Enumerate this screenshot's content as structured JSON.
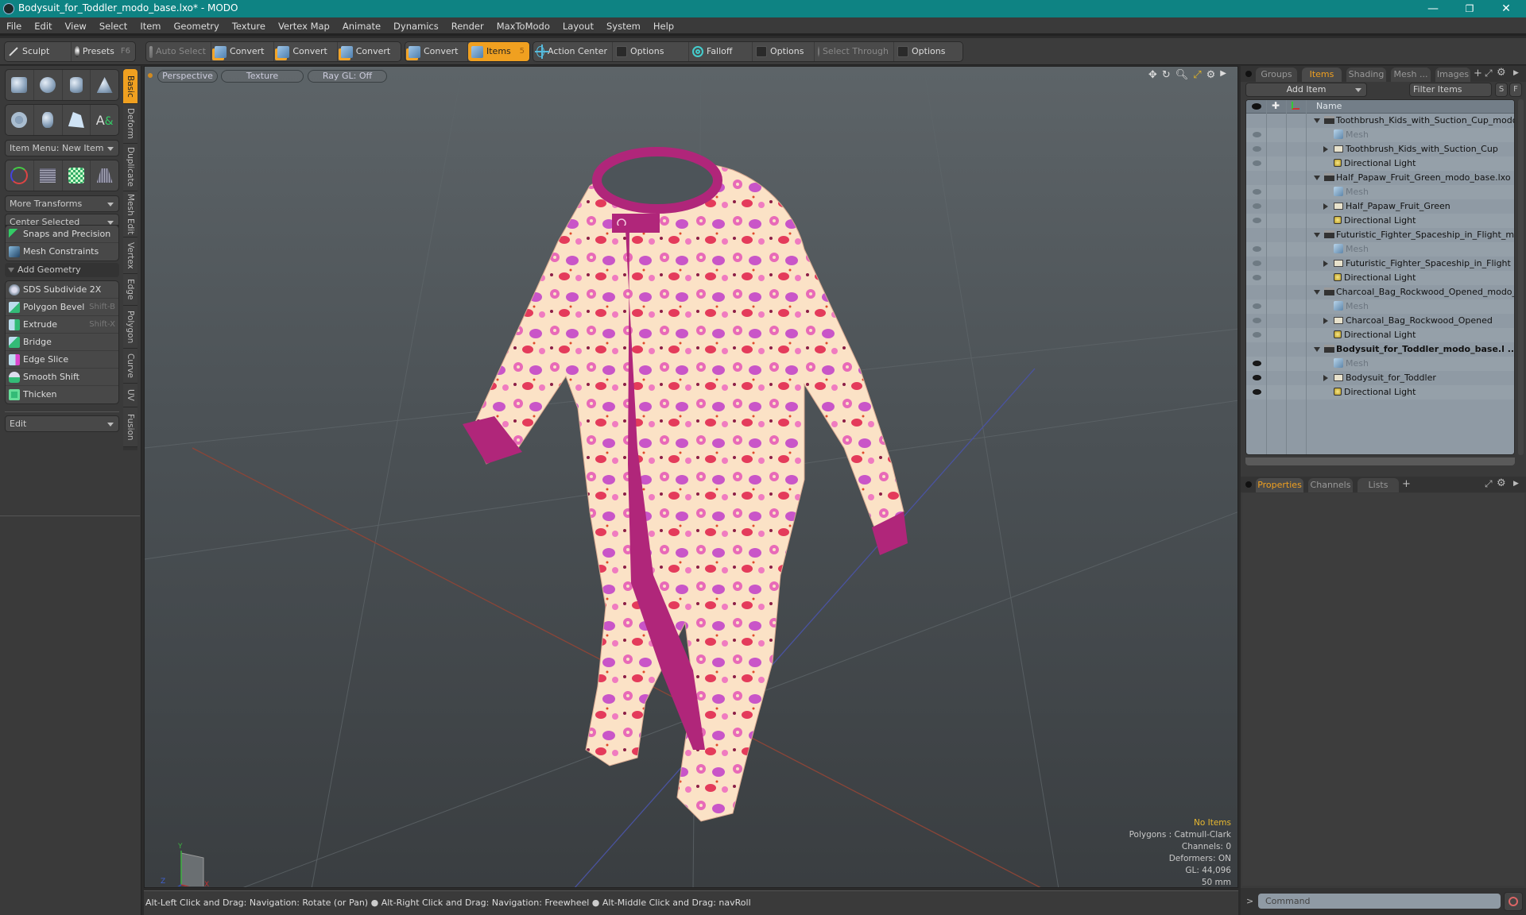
{
  "window": {
    "title": "Bodysuit_for_Toddler_modo_base.lxo* - MODO",
    "controls": {
      "minimize": "—",
      "maximize": "❐",
      "close": "✕"
    }
  },
  "menu": [
    "File",
    "Edit",
    "View",
    "Select",
    "Item",
    "Geometry",
    "Texture",
    "Vertex Map",
    "Animate",
    "Dynamics",
    "Render",
    "MaxToModo",
    "Layout",
    "System",
    "Help"
  ],
  "toolbar": {
    "sculpt": "Sculpt",
    "presets": "Presets",
    "presets_key": "F6",
    "auto_select": "Auto Select",
    "convert1": "Convert",
    "convert2": "Convert",
    "convert3": "Convert",
    "convert4": "Convert",
    "items": "Items",
    "items_count": "5",
    "action_center": "Action Center",
    "options1": "Options",
    "falloff": "Falloff",
    "options2": "Options",
    "select_through": "Select Through",
    "options3": "Options"
  },
  "left_panel": {
    "item_menu": "Item Menu: New Item",
    "more_transforms": "More Transforms",
    "center_selected": "Center Selected",
    "snaps": "Snaps and Precision",
    "mesh_constraints": "Mesh Constraints",
    "add_geometry": "Add Geometry",
    "tools": [
      {
        "label": "SDS Subdivide 2X",
        "shortcut": ""
      },
      {
        "label": "Polygon Bevel",
        "shortcut": "Shift-B"
      },
      {
        "label": "Extrude",
        "shortcut": "Shift-X"
      },
      {
        "label": "Bridge",
        "shortcut": ""
      },
      {
        "label": "Edge Slice",
        "shortcut": ""
      },
      {
        "label": "Smooth Shift",
        "shortcut": ""
      },
      {
        "label": "Thicken",
        "shortcut": ""
      }
    ],
    "edit_dropdown": "Edit",
    "vertical_tabs": [
      "Basic",
      "Deform",
      "Duplicate",
      "Mesh Edit",
      "Vertex",
      "Edge",
      "Polygon",
      "Curve",
      "UV",
      "Fusion"
    ]
  },
  "viewport": {
    "view": "Perspective",
    "shading": "Texture",
    "raygl": "Ray GL: Off",
    "info": {
      "selection": "No Items",
      "polygons": "Polygons : Catmull-Clark",
      "channels": "Channels: 0",
      "deformers": "Deformers: ON",
      "gl": "GL: 44,096",
      "focal": "50 mm"
    },
    "axis": {
      "x": "X",
      "y": "Y",
      "z": "Z"
    }
  },
  "right_panel": {
    "tabs": [
      "Groups",
      "Items",
      "Shading",
      "Mesh ...",
      "Images"
    ],
    "active_tab": "Items",
    "add_item": "Add Item",
    "filter_placeholder": "Filter Items",
    "s_btn": "S",
    "f_btn": "F",
    "name_header": "Name",
    "items": [
      {
        "type": "scene",
        "label": "Toothbrush_Kids_with_Suction_Cup_modo ...",
        "visible": false,
        "bold": false
      },
      {
        "type": "mesh",
        "label": "Mesh",
        "visible": false
      },
      {
        "type": "group",
        "label": "Toothbrush_Kids_with_Suction_Cup",
        "visible": false
      },
      {
        "type": "light",
        "label": "Directional Light",
        "visible": false
      },
      {
        "type": "scene",
        "label": "Half_Papaw_Fruit_Green_modo_base.lxo",
        "visible": false,
        "bold": false
      },
      {
        "type": "mesh",
        "label": "Mesh",
        "visible": false
      },
      {
        "type": "group",
        "label": "Half_Papaw_Fruit_Green",
        "visible": false
      },
      {
        "type": "light",
        "label": "Directional Light",
        "visible": false
      },
      {
        "type": "scene",
        "label": "Futuristic_Fighter_Spaceship_in_Flight_mo ...",
        "visible": false,
        "bold": false
      },
      {
        "type": "mesh",
        "label": "Mesh",
        "visible": false
      },
      {
        "type": "group",
        "label": "Futuristic_Fighter_Spaceship_in_Flight",
        "visible": false
      },
      {
        "type": "light",
        "label": "Directional Light",
        "visible": false
      },
      {
        "type": "scene",
        "label": "Charcoal_Bag_Rockwood_Opened_modo_ ...",
        "visible": false,
        "bold": false
      },
      {
        "type": "mesh",
        "label": "Mesh",
        "visible": false
      },
      {
        "type": "group",
        "label": "Charcoal_Bag_Rockwood_Opened",
        "visible": false
      },
      {
        "type": "light",
        "label": "Directional Light",
        "visible": false
      },
      {
        "type": "scene",
        "label": "Bodysuit_for_Toddler_modo_base.l ...",
        "visible": true,
        "bold": true
      },
      {
        "type": "mesh",
        "label": "Mesh",
        "visible": true
      },
      {
        "type": "group",
        "label": "Bodysuit_for_Toddler",
        "visible": true
      },
      {
        "type": "light",
        "label": "Directional Light",
        "visible": true
      }
    ],
    "bottom_tabs": [
      "Properties",
      "Channels",
      "Lists"
    ],
    "bottom_active": "Properties"
  },
  "statusbar": {
    "hint1": "Alt-Left Click and Drag: Navigation: Rotate (or Pan)",
    "hint2": "Alt-Right Click and Drag: Navigation: Freewheel",
    "hint3": "Alt-Middle Click and Drag: navRoll"
  },
  "command": {
    "placeholder": "Command",
    "prompt": ">"
  },
  "colors": {
    "accent": "#f0a020",
    "titlebar": "#0e8383",
    "suit_base": "#fbe4c8",
    "suit_trim": "#b0267a"
  }
}
